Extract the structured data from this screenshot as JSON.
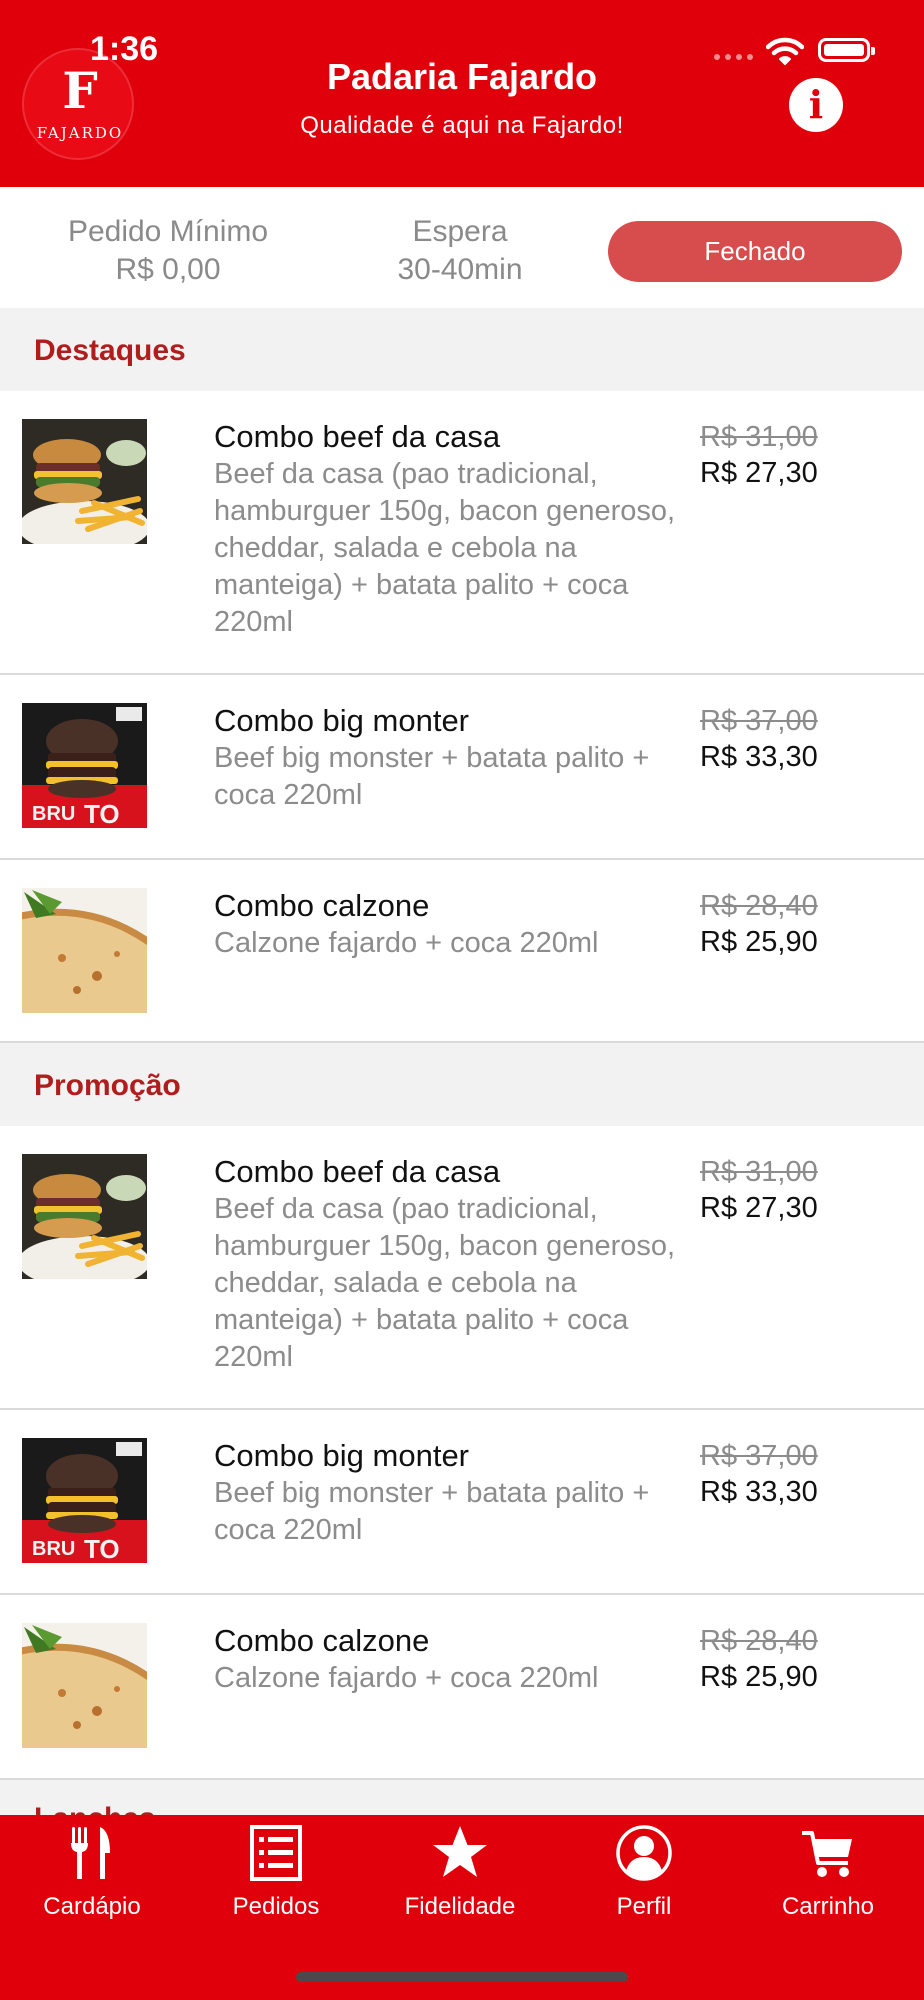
{
  "status_bar": {
    "time": "1:36"
  },
  "header": {
    "logo_mark": "F",
    "logo_text": "FAJARDO",
    "store_name": "Padaria Fajardo",
    "tagline": "Qualidade é aqui na Fajardo!",
    "info_button": "i"
  },
  "info_bar": {
    "min_order_label": "Pedido Mínimo",
    "min_order_value": "R$ 0,00",
    "wait_label": "Espera",
    "wait_value": "30-40min",
    "status_label": "Fechado"
  },
  "sections": [
    {
      "title": "Destaques",
      "items": [
        {
          "name": "Combo beef da casa",
          "description": "Beef da casa (pao tradicional, hamburguer 150g,  bacon generoso,  cheddar,  salada e cebola na manteiga)  + batata palito + coca 220ml",
          "old_price": "R$ 31,00",
          "price": "R$ 27,30",
          "image": "burger-fries-photo"
        },
        {
          "name": "Combo big monter",
          "description": "Beef big monster + batata palito + coca 220ml",
          "old_price": "R$ 37,00",
          "price": "R$ 33,30",
          "image": "big-burger-poster-photo"
        },
        {
          "name": "Combo calzone",
          "description": "Calzone fajardo + coca 220ml",
          "old_price": "R$ 28,40",
          "price": "R$ 25,90",
          "image": "calzone-photo"
        }
      ]
    },
    {
      "title": "Promoção",
      "items": [
        {
          "name": "Combo beef da casa",
          "description": "Beef da casa (pao tradicional, hamburguer 150g,  bacon generoso,  cheddar,  salada e cebola na manteiga)  + batata palito + coca 220ml",
          "old_price": "R$ 31,00",
          "price": "R$ 27,30",
          "image": "burger-fries-photo"
        },
        {
          "name": "Combo big monter",
          "description": "Beef big monster + batata palito + coca 220ml",
          "old_price": "R$ 37,00",
          "price": "R$ 33,30",
          "image": "big-burger-poster-photo"
        },
        {
          "name": "Combo calzone",
          "description": "Calzone fajardo + coca 220ml",
          "old_price": "R$ 28,40",
          "price": "R$ 25,90",
          "image": "calzone-photo"
        }
      ]
    },
    {
      "title": "Lanches"
    }
  ],
  "tab_bar": {
    "tabs": [
      {
        "label": "Cardápio",
        "icon": "fork-knife-icon"
      },
      {
        "label": "Pedidos",
        "icon": "list-icon"
      },
      {
        "label": "Fidelidade",
        "icon": "star-icon"
      },
      {
        "label": "Perfil",
        "icon": "user-icon"
      },
      {
        "label": "Carrinho",
        "icon": "cart-icon"
      }
    ]
  },
  "colors": {
    "brand_red": "#e0000b",
    "closed_button": "#d74c4c",
    "section_title": "#b01d1d"
  }
}
